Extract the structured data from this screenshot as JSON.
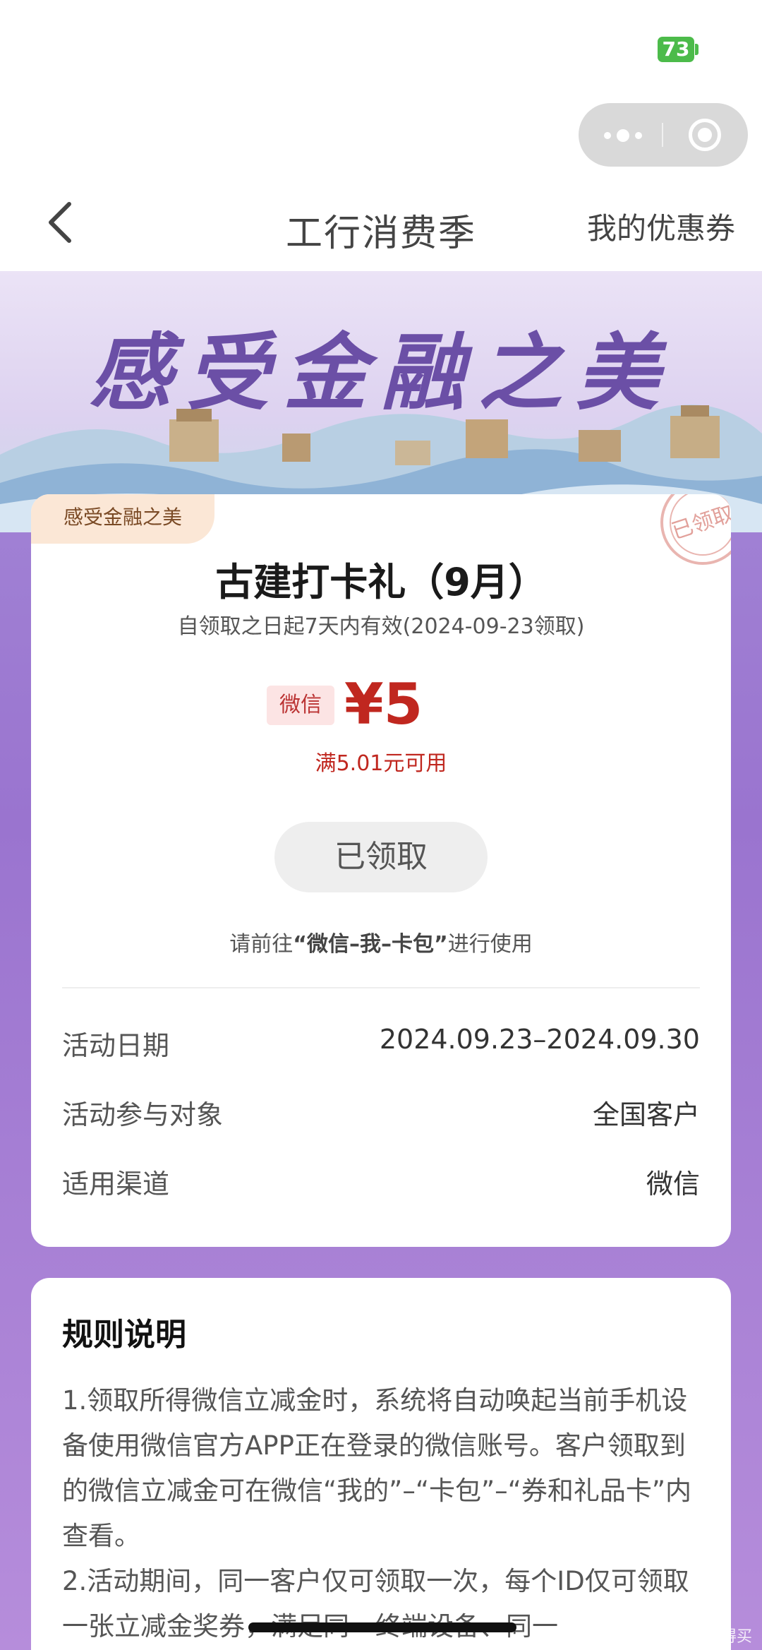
{
  "status_bar": {
    "battery": "73"
  },
  "nav": {
    "title": "工行消费季",
    "right_link": "我的优惠券"
  },
  "banner": {
    "title": "感受金融之美"
  },
  "coupon": {
    "tag": "感受金融之美",
    "stamp": "已领取",
    "title": "古建打卡礼（9月）",
    "validity": "自领取之日起7天内有效(2024-09-23领取)",
    "channel_tag": "微信",
    "amount": "¥5",
    "min_spend": "满5.01元可用",
    "button_label": "已领取",
    "hint_prefix": "请前往",
    "hint_bold": "“微信–我–卡包”",
    "hint_suffix": "进行使用",
    "info": [
      {
        "label": "活动日期",
        "value": "2024.09.23–2024.09.30"
      },
      {
        "label": "活动参与对象",
        "value": "全国客户"
      },
      {
        "label": "适用渠道",
        "value": "微信"
      }
    ]
  },
  "rules": {
    "title": "规则说明",
    "text": "1.领取所得微信立减金时，系统将自动唤起当前手机设备使用微信官方APP正在登录的微信账号。客户领取到的微信立减金可在微信“我的”–“卡包”–“券和礼品卡”内查看。\n2.活动期间，同一客户仅可领取一次，每个ID仅可领取一张立减金奖券，满足同一终端设备、同一"
  },
  "watermark": "值 什么值得买",
  "colors": {
    "accent_red": "#c0271f",
    "battery_green": "#4cbb4a",
    "purple_bg": "#9a74cf"
  }
}
